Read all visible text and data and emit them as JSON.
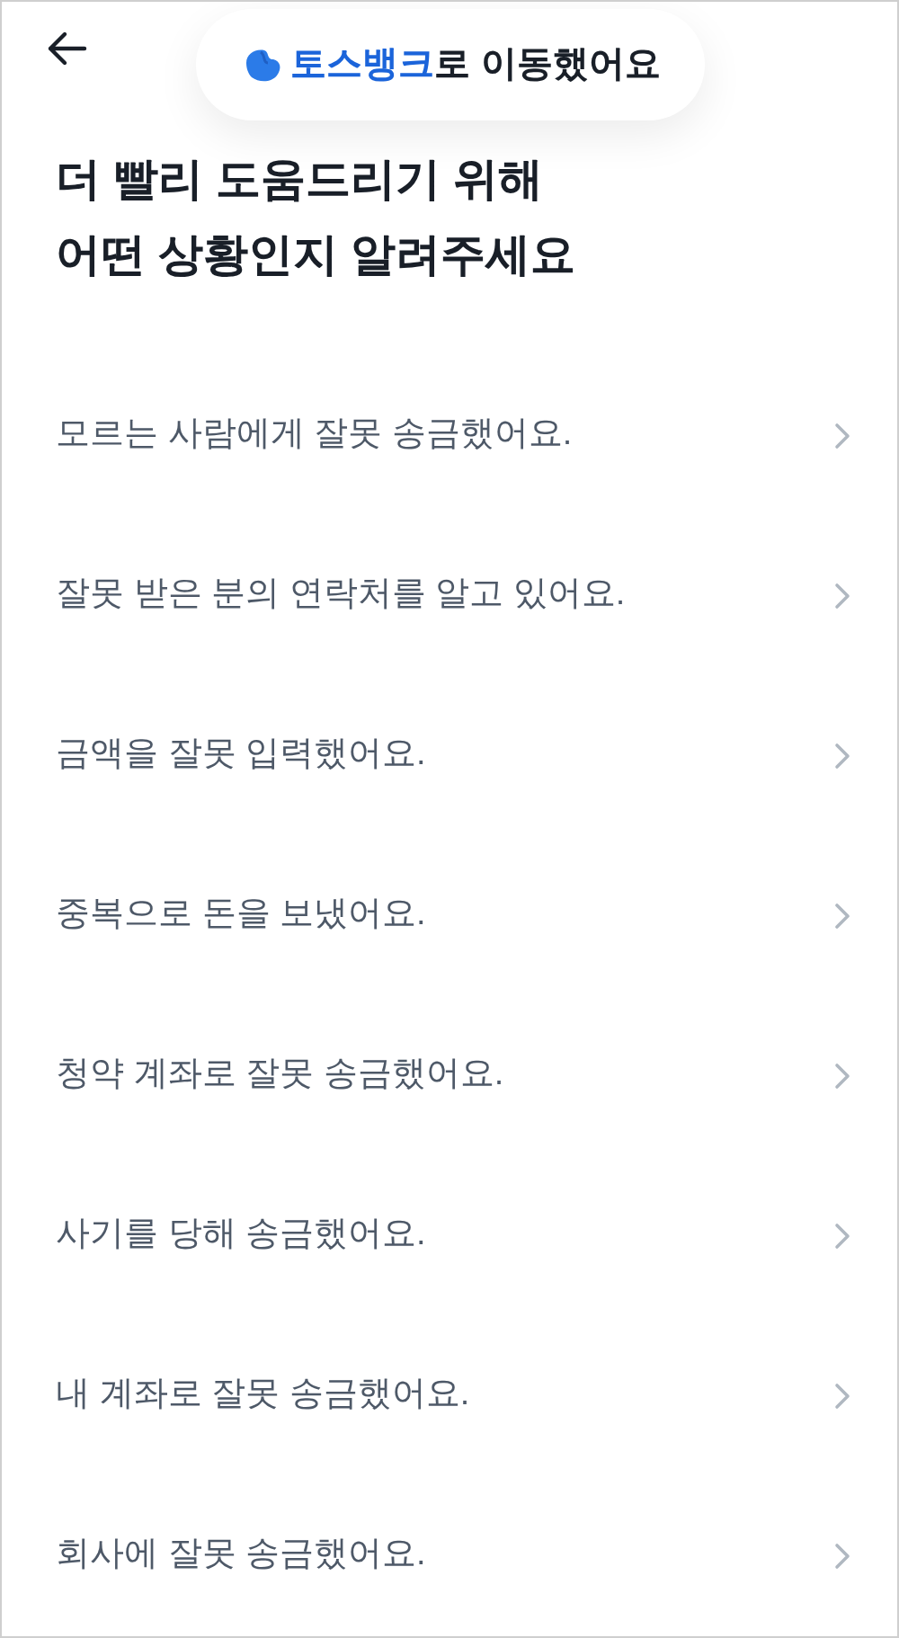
{
  "toast": {
    "brand": "토스뱅크",
    "text": "로 이동했어요"
  },
  "title": [
    "더 빨리 도움드리기 위해",
    "어떤 상황인지 알려주세요"
  ],
  "options": [
    "모르는 사람에게 잘못 송금했어요.",
    "잘못 받은 분의 연락처를 알고 있어요.",
    "금액을 잘못 입력했어요.",
    "중복으로 돈을 보냈어요.",
    "청약 계좌로 잘못 송금했어요.",
    "사기를 당해 송금했어요.",
    "내 계좌로 잘못 송금했어요.",
    "회사에 잘못 송금했어요."
  ]
}
